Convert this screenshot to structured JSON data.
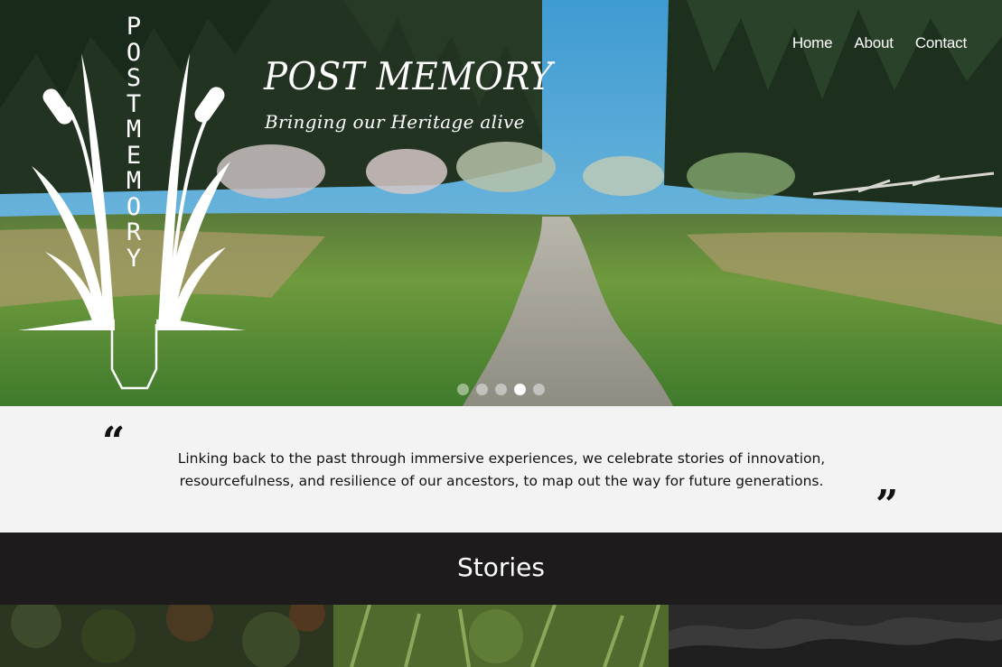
{
  "nav": {
    "items": [
      {
        "label": "Home"
      },
      {
        "label": "About"
      },
      {
        "label": "Contact"
      }
    ]
  },
  "hero": {
    "title": "POST MEMORY",
    "subtitle": "Bringing our Heritage alive",
    "logo_text": "POST MEMORY",
    "slides_count": 5,
    "active_slide": 4
  },
  "quote": {
    "open_mark": "“",
    "close_mark": "”",
    "text": "Linking back to the past through immersive experiences, we celebrate stories of innovation, resourcefulness, and resilience of our ancestors, to map out the way for future generations."
  },
  "stories": {
    "title": "Stories"
  },
  "colors": {
    "quote_bg": "#f3f3f3",
    "dark_bg": "#1d1b1c",
    "text_light": "#ffffff"
  }
}
